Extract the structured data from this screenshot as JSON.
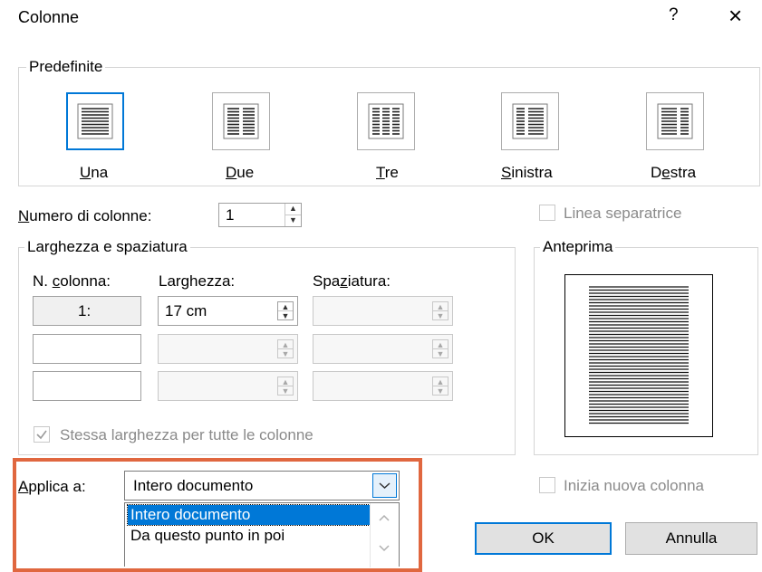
{
  "dialog": {
    "title": "Colonne",
    "help": "?",
    "close": "×"
  },
  "presets": {
    "group_label": "Predefinite",
    "items": [
      {
        "pre": "",
        "key": "U",
        "post": "na"
      },
      {
        "pre": "",
        "key": "D",
        "post": "ue"
      },
      {
        "pre": "",
        "key": "T",
        "post": "re"
      },
      {
        "pre": "",
        "key": "S",
        "post": "inistra"
      },
      {
        "pre": "D",
        "key": "e",
        "post": "stra"
      }
    ]
  },
  "num_columns": {
    "pre": "",
    "key": "N",
    "post": "umero di colonne:",
    "value": "1"
  },
  "separator": {
    "label": "Linea separatrice"
  },
  "width_spacing": {
    "group_label": "Larghezza e spaziatura",
    "col_header": {
      "pre": "N. ",
      "key": "c",
      "post": "olonna:"
    },
    "width_header": {
      "pre": "Lar",
      "key": "g",
      "post": "hezza:"
    },
    "spacing_header": {
      "pre": "Spa",
      "key": "z",
      "post": "iatura:"
    },
    "rows": [
      {
        "col": "1:",
        "width": "17 cm",
        "spacing": ""
      },
      {
        "col": "",
        "width": "",
        "spacing": ""
      },
      {
        "col": "",
        "width": "",
        "spacing": ""
      }
    ],
    "equal_width": {
      "label": "Stessa larghezza per tutte le colonne",
      "checked": true
    }
  },
  "preview": {
    "group_label": "Anteprima"
  },
  "apply_to": {
    "pre": "",
    "key": "A",
    "post": "pplica a:",
    "value": "Intero documento",
    "options": [
      "Intero documento",
      "Da questo punto in poi"
    ]
  },
  "new_column": {
    "label": "Inizia nuova colonna"
  },
  "buttons": {
    "ok": "OK",
    "cancel": "Annulla"
  },
  "colors": {
    "accent": "#0078d7",
    "highlight_border": "#e0673f"
  }
}
